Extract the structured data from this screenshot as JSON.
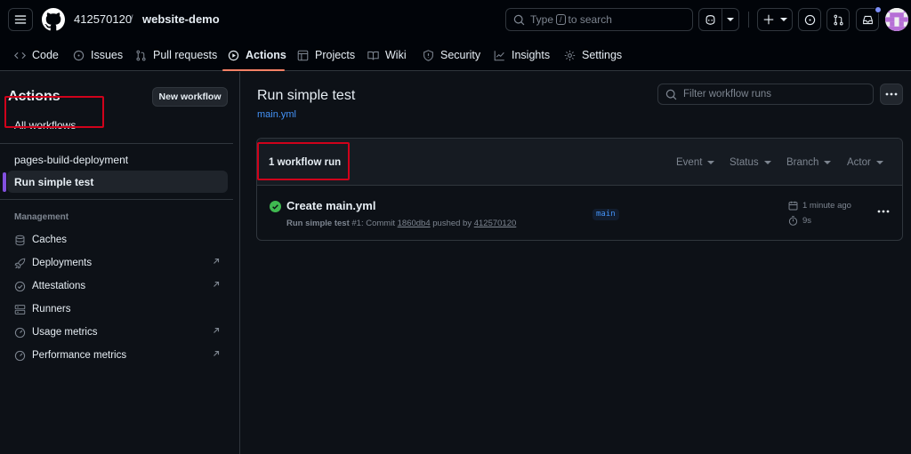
{
  "header": {
    "owner": "412570120",
    "separator": "/",
    "repo": "website-demo",
    "search_prefix": "Type",
    "search_key": "/",
    "search_suffix": "to search"
  },
  "tabs": [
    {
      "label": "Code",
      "icon": "code-icon"
    },
    {
      "label": "Issues",
      "icon": "issue-icon"
    },
    {
      "label": "Pull requests",
      "icon": "pull-request-icon"
    },
    {
      "label": "Actions",
      "icon": "play-icon",
      "active": true
    },
    {
      "label": "Projects",
      "icon": "table-icon"
    },
    {
      "label": "Wiki",
      "icon": "book-icon"
    },
    {
      "label": "Security",
      "icon": "shield-icon"
    },
    {
      "label": "Insights",
      "icon": "graph-icon"
    },
    {
      "label": "Settings",
      "icon": "gear-icon"
    }
  ],
  "sidebar": {
    "title": "Actions",
    "new_workflow": "New workflow",
    "all_workflows": "All workflows",
    "workflows": [
      "pages-build-deployment",
      "Run simple test"
    ],
    "selected_workflow": "Run simple test",
    "management_heading": "Management",
    "management": [
      {
        "label": "Caches",
        "icon": "database-icon",
        "external": false
      },
      {
        "label": "Deployments",
        "icon": "rocket-icon",
        "external": true
      },
      {
        "label": "Attestations",
        "icon": "verified-icon",
        "external": true
      },
      {
        "label": "Runners",
        "icon": "server-icon",
        "external": false
      },
      {
        "label": "Usage metrics",
        "icon": "meter-icon",
        "external": true
      },
      {
        "label": "Performance metrics",
        "icon": "meter-icon",
        "external": true
      }
    ]
  },
  "main": {
    "title": "Run simple test",
    "file": "main.yml",
    "filter_placeholder": "Filter workflow runs",
    "run_count": "1 workflow run",
    "filters": [
      "Event",
      "Status",
      "Branch",
      "Actor"
    ],
    "run": {
      "title": "Create main.yml",
      "workflow": "Run simple test",
      "number": "#1",
      "commit_label": "Commit",
      "commit": "1860db4",
      "pushed_by_label": "pushed by",
      "actor": "412570120",
      "branch": "main",
      "time": "1 minute ago",
      "duration": "9s",
      "status": "success"
    }
  },
  "colors": {
    "background": "#0d1117",
    "header": "#010409",
    "accent_link": "#4493f8",
    "tab_underline": "#f78166",
    "success": "#3fb950",
    "highlight_box": "#d0021b",
    "selected_bar": "#8250df"
  }
}
